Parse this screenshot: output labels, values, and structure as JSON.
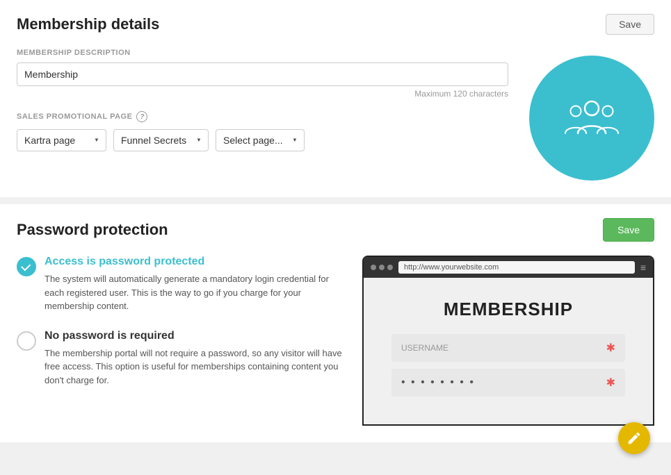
{
  "page": {
    "title": "Membership details"
  },
  "membership_section": {
    "title": "Membership details",
    "save_button": "Save",
    "description_label": "MEMBERSHIP DESCRIPTION",
    "description_value": "Membership",
    "description_placeholder": "Membership",
    "char_hint": "Maximum 120 characters",
    "promo_label": "SALES PROMOTIONAL PAGE",
    "dropdown1_selected": "Kartra page",
    "dropdown2_selected": "Funnel Secrets",
    "dropdown3_placeholder": "Select page..."
  },
  "password_section": {
    "title": "Password protection",
    "save_button": "Save",
    "option1_title": "Access is password protected",
    "option1_desc": "The system will automatically generate a mandatory login credential for each registered user. This is the way to go if you charge for your membership content.",
    "option1_selected": true,
    "option2_title": "No password is required",
    "option2_desc": "The membership portal will not require a password, so any visitor will have free access. This option is useful for memberships containing content you don't charge for.",
    "option2_selected": false,
    "browser": {
      "url": "http://www.yourwebsite.com",
      "membership_label": "MEMBERSHIP",
      "username_placeholder": "USERNAME",
      "password_dots": "• • • • • • • •"
    }
  },
  "fab": {
    "label": "edit-fab"
  }
}
